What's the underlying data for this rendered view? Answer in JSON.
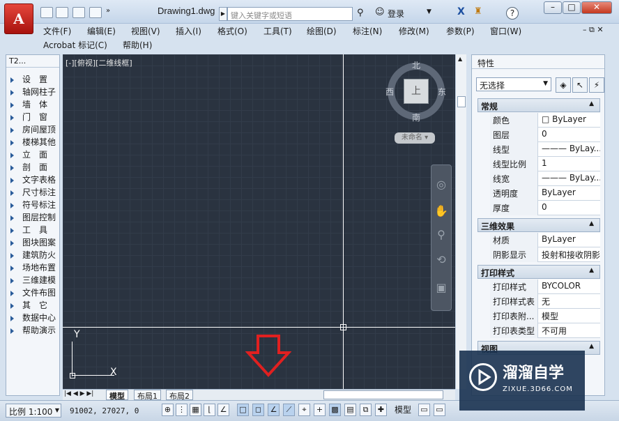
{
  "title_bar": {
    "file_name": "Drawing1.dwg",
    "search_placeholder": "键入关键字或短语",
    "login": "登录",
    "app_logo": "A"
  },
  "menu_row1": [
    "文件(F)",
    "编辑(E)",
    "视图(V)",
    "插入(I)",
    "格式(O)",
    "工具(T)",
    "绘图(D)",
    "标注(N)",
    "修改(M)",
    "参数(P)",
    "窗口(W)"
  ],
  "menu_row2": [
    "Acrobat 标记(C)",
    "帮助(H)"
  ],
  "left_panel": {
    "title": "T2...",
    "items": [
      "设　置",
      "轴网柱子",
      "墙　体",
      "门　窗",
      "房间屋顶",
      "楼梯其他",
      "立　面",
      "剖　面",
      "文字表格",
      "尺寸标注",
      "符号标注",
      "图层控制",
      "工　具",
      "图块图案",
      "建筑防火",
      "场地布置",
      "三维建模",
      "文件布图",
      "其　它",
      "数据中心",
      "帮助演示"
    ]
  },
  "canvas": {
    "view_label": "[-][俯视][二维线框]",
    "compass": {
      "north": "北",
      "south": "南",
      "east": "东",
      "west": "西"
    },
    "viewcube_face": "上",
    "ucs_name": "未命名",
    "axis_x": "X",
    "axis_y": "Y"
  },
  "layout_tabs": [
    "模型",
    "布局1",
    "布局2"
  ],
  "properties": {
    "title": "特性",
    "selection": "无选择",
    "sections": [
      {
        "title": "常规",
        "rows": [
          {
            "k": "颜色",
            "v": "□ ByLayer"
          },
          {
            "k": "图层",
            "v": "0"
          },
          {
            "k": "线型",
            "v": "——— ByLay..."
          },
          {
            "k": "线型比例",
            "v": "1"
          },
          {
            "k": "线宽",
            "v": "——— ByLay..."
          },
          {
            "k": "透明度",
            "v": "ByLayer"
          },
          {
            "k": "厚度",
            "v": "0"
          }
        ]
      },
      {
        "title": "三维效果",
        "rows": [
          {
            "k": "材质",
            "v": "ByLayer"
          },
          {
            "k": "阴影显示",
            "v": "投射和接收阴影"
          }
        ]
      },
      {
        "title": "打印样式",
        "rows": [
          {
            "k": "打印样式",
            "v": "BYCOLOR"
          },
          {
            "k": "打印样式表",
            "v": "无"
          },
          {
            "k": "打印表附...",
            "v": "模型"
          },
          {
            "k": "打印表类型",
            "v": "不可用"
          }
        ]
      },
      {
        "title": "视图",
        "rows": []
      }
    ]
  },
  "status_bar": {
    "scale": "比例 1:100",
    "coords": "91002, 27027, 0",
    "model": "模型"
  },
  "watermark": {
    "title": "溜溜自学",
    "url": "ZIXUE.3D66.COM"
  },
  "colors": {
    "canvas_bg": "#2a3340",
    "accent": "#c4381f",
    "arrow": "#e02020"
  }
}
